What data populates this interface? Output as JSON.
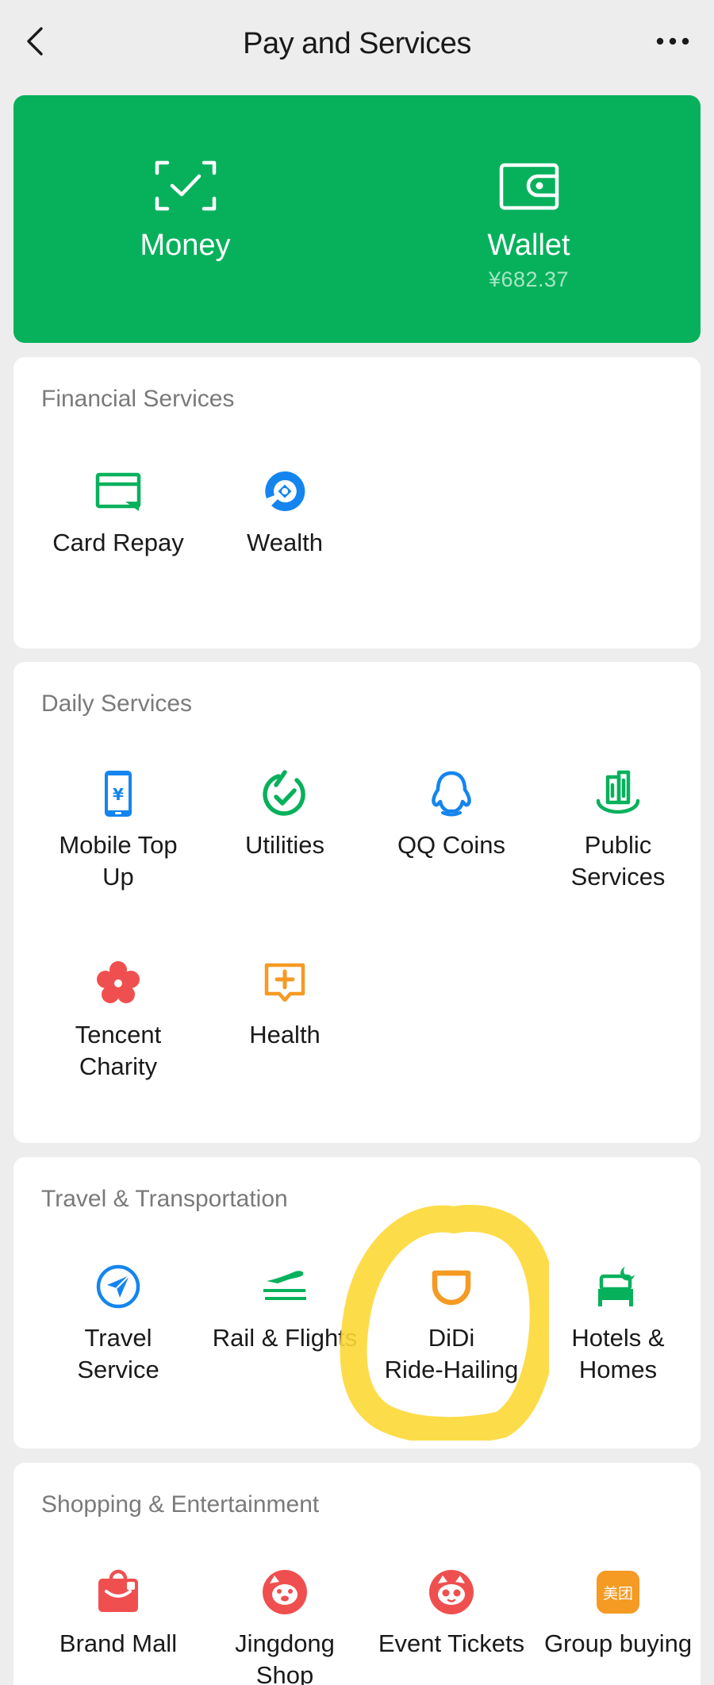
{
  "header": {
    "title": "Pay and Services",
    "back_icon": "chevron-left-icon",
    "more_icon": "more-dots-icon"
  },
  "top_card": {
    "color": "#07b15c",
    "money": {
      "label": "Money",
      "icon": "scan-check-icon"
    },
    "wallet": {
      "label": "Wallet",
      "balance": "¥682.37",
      "icon": "wallet-icon"
    }
  },
  "financial": {
    "title": "Financial Services",
    "items": [
      {
        "label": "Card Repay",
        "icon": "card-repay-icon",
        "color": "#07b15c"
      },
      {
        "label": "Wealth",
        "icon": "wealth-icon",
        "color": "#1485ee"
      }
    ]
  },
  "daily": {
    "title": "Daily Services",
    "items": [
      {
        "label": "Mobile Top\nUp",
        "icon": "mobile-topup-icon",
        "color": "#1485ee"
      },
      {
        "label": "Utilities",
        "icon": "utilities-icon",
        "color": "#07b15c"
      },
      {
        "label": "QQ Coins",
        "icon": "qq-coins-icon",
        "color": "#1485ee"
      },
      {
        "label": "Public\nServices",
        "icon": "public-services-icon",
        "color": "#07b15c"
      },
      {
        "label": "Tencent\nCharity",
        "icon": "charity-flower-icon",
        "color": "#f04f4f"
      },
      {
        "label": "Health",
        "icon": "health-icon",
        "color": "#f59a23"
      }
    ]
  },
  "travel": {
    "title": "Travel & Transportation",
    "items": [
      {
        "label": "Travel\nService",
        "icon": "travel-compass-icon",
        "color": "#1485ee"
      },
      {
        "label": "Rail & Flights",
        "icon": "rail-flights-icon",
        "color": "#07b15c"
      },
      {
        "label": "DiDi\nRide-Hailing",
        "icon": "didi-icon",
        "color": "#f59a23"
      },
      {
        "label": "Hotels &\nHomes",
        "icon": "hotel-bed-icon",
        "color": "#07b15c"
      }
    ]
  },
  "shopping": {
    "title": "Shopping & Entertainment",
    "items": [
      {
        "label": "Brand Mall",
        "icon": "brand-mall-icon",
        "color": "#f04f4f"
      },
      {
        "label": "Jingdong\nShop",
        "icon": "jingdong-icon",
        "color": "#f04f4f"
      },
      {
        "label": "Event Tickets",
        "icon": "event-tickets-icon",
        "color": "#f04f4f"
      },
      {
        "label": "Group buying",
        "icon": "group-buying-icon",
        "color": "#f59a23",
        "glyph": "美团"
      }
    ]
  },
  "annotation": {
    "color": "#fdd835"
  }
}
